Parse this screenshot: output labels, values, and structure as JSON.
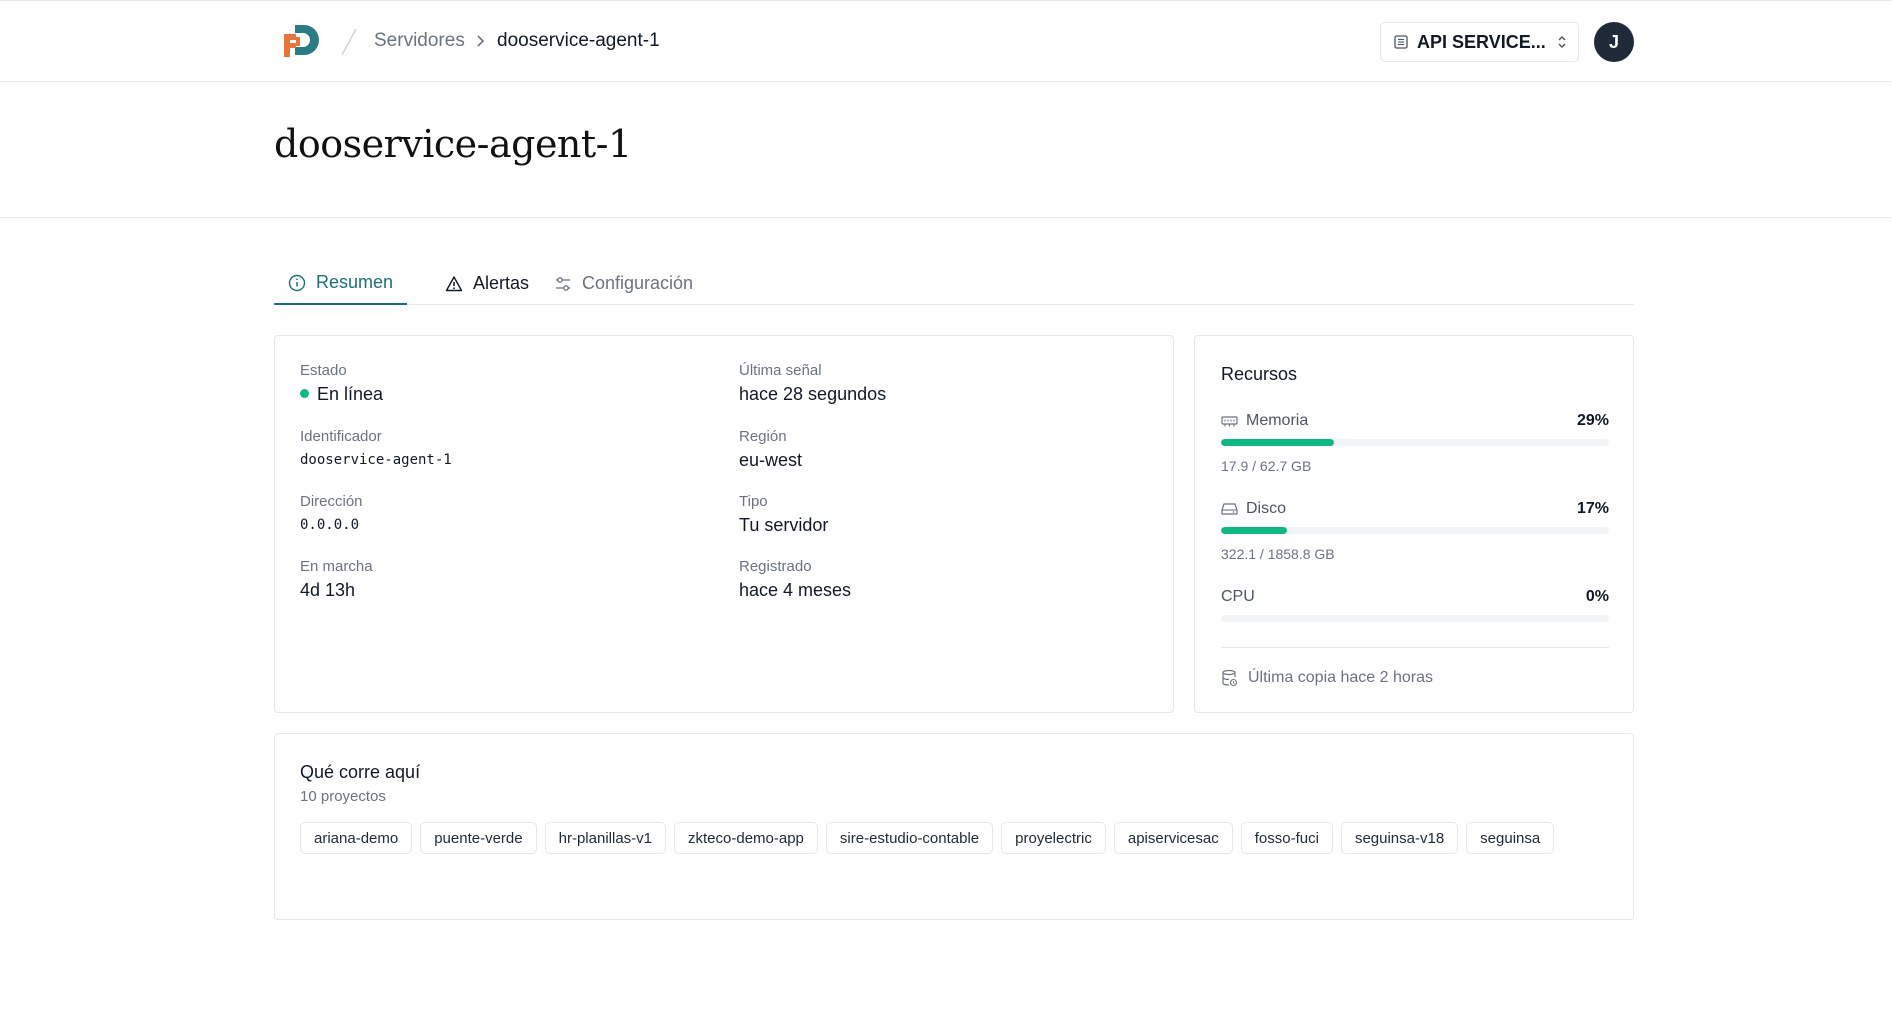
{
  "header": {
    "breadcrumb_parent": "Servidores",
    "breadcrumb_current": "dooservice-agent-1",
    "org_label": "API SERVICE...",
    "avatar_initial": "J"
  },
  "page": {
    "title": "dooservice-agent-1"
  },
  "tabs": [
    {
      "label": "Resumen",
      "icon": "info-icon",
      "active": true
    },
    {
      "label": "Alertas",
      "icon": "warning-triangle-icon",
      "active": false
    },
    {
      "label": "Configuración",
      "icon": "sliders-icon",
      "active": false
    }
  ],
  "info": {
    "estado": {
      "label": "Estado",
      "value": "En línea"
    },
    "identificador": {
      "label": "Identificador",
      "value": "dooservice-agent-1"
    },
    "direccion": {
      "label": "Dirección",
      "value": "0.0.0.0"
    },
    "en_marcha": {
      "label": "En marcha",
      "value": "4d 13h"
    },
    "ultima_senal": {
      "label": "Última señal",
      "value": "hace 28 segundos"
    },
    "region": {
      "label": "Región",
      "value": "eu-west"
    },
    "tipo": {
      "label": "Tipo",
      "value": "Tu servidor"
    },
    "registrado": {
      "label": "Registrado",
      "value": "hace 4 meses"
    }
  },
  "resources": {
    "title": "Recursos",
    "memory": {
      "label": "Memoria",
      "percent_text": "29%",
      "fraction": 0.29,
      "usage": "17.9 / 62.7 GB"
    },
    "disk": {
      "label": "Disco",
      "percent_text": "17%",
      "fraction": 0.17,
      "usage": "322.1 / 1858.8 GB"
    },
    "cpu": {
      "label": "CPU",
      "percent_text": "0%",
      "fraction": 0
    },
    "backup": "Última copia hace 2 horas"
  },
  "projects": {
    "title": "Qué corre aquí",
    "count": "10 proyectos",
    "items": [
      "ariana-demo",
      "puente-verde",
      "hr-planillas-v1",
      "zkteco-demo-app",
      "sire-estudio-contable",
      "proyelectric",
      "apiservicesac",
      "fosso-fuci",
      "seguinsa-v18",
      "seguinsa"
    ]
  },
  "colors": {
    "accent": "#1f6f77",
    "success": "#10b981",
    "logo_orange": "#e8743b",
    "logo_teal": "#2a7b83"
  }
}
